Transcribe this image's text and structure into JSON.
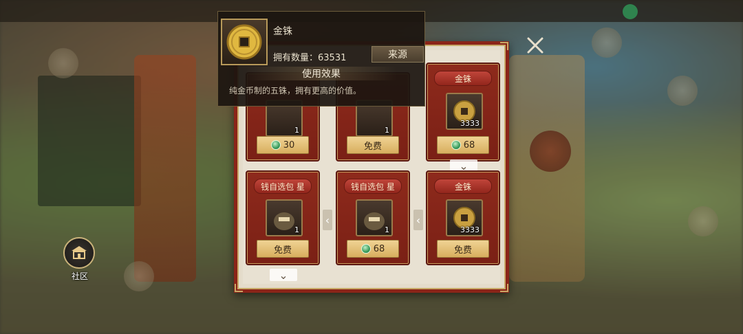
{
  "community": {
    "label": "社区"
  },
  "tooltip": {
    "item_name": "金铢",
    "owned_label": "拥有数量：",
    "owned_count": "63531",
    "source_button": "来源",
    "effect_heading": "使用效果",
    "description": "纯金币制的五铢，拥有更高的价值。"
  },
  "shop": {
    "cards": [
      {
        "ribbon": "",
        "quantity": "1",
        "price": "30",
        "currency": "gem"
      },
      {
        "ribbon": "",
        "quantity": "1",
        "price": "免费",
        "currency": ""
      },
      {
        "ribbon": "金铢",
        "quantity": "3333",
        "price": "68",
        "currency": "gem"
      },
      {
        "ribbon": "钱自选包 星",
        "quantity": "1",
        "price": "免费",
        "currency": ""
      },
      {
        "ribbon": "钱自选包 星",
        "quantity": "1",
        "price": "68",
        "currency": "gem"
      },
      {
        "ribbon": "金铢",
        "quantity": "3333",
        "price": "免费",
        "currency": ""
      }
    ]
  },
  "colors": {
    "panel_border": "#8a2418",
    "card_red": "#8e2a1c",
    "price_gold": "#e6c27a",
    "gem_green": "#3a9a5a"
  }
}
